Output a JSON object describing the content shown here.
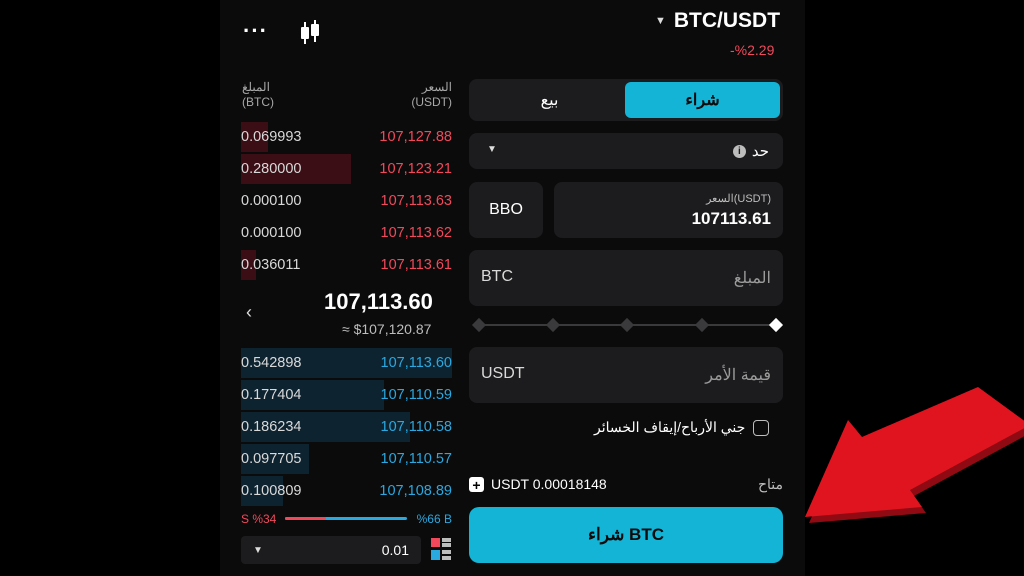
{
  "header": {
    "pair": "BTC/USDT",
    "change": "-%2.29",
    "more_icon": "more-horizontal-icon",
    "chart_icon": "candlestick-icon"
  },
  "orderbook": {
    "amount_label": "المبلغ",
    "amount_unit": "(BTC)",
    "price_label": "السعر",
    "price_unit": "(USDT)",
    "asks": [
      {
        "amount": "0.069993",
        "price": "107,127.88",
        "depth": 0.13
      },
      {
        "amount": "0.280000",
        "price": "107,123.21",
        "depth": 0.52
      },
      {
        "amount": "0.000100",
        "price": "107,113.63",
        "depth": 0.0
      },
      {
        "amount": "0.000100",
        "price": "107,113.62",
        "depth": 0.0
      },
      {
        "amount": "0.036011",
        "price": "107,113.61",
        "depth": 0.07
      }
    ],
    "mid_price": "107,113.60",
    "mid_fiat": "≈ $107,120.87",
    "bids": [
      {
        "amount": "0.542898",
        "price": "107,113.60",
        "depth": 1.0
      },
      {
        "amount": "0.177404",
        "price": "107,110.59",
        "depth": 0.68
      },
      {
        "amount": "0.186234",
        "price": "107,110.58",
        "depth": 0.8
      },
      {
        "amount": "0.097705",
        "price": "107,110.57",
        "depth": 0.32
      },
      {
        "amount": "0.100809",
        "price": "107,108.89",
        "depth": 0.2
      }
    ],
    "sell_ratio": "S %34",
    "buy_ratio": "%66 B",
    "sell_fraction": 0.34,
    "precision": "0.01"
  },
  "trade": {
    "buy_tab": "شراء",
    "sell_tab": "بيع",
    "order_type": "حد",
    "bbo": "BBO",
    "price_label": "السعر(USDT)",
    "price_value": "107113.61",
    "amount_placeholder": "المبلغ",
    "amount_unit": "BTC",
    "value_placeholder": "قيمة الأمر",
    "value_unit": "USDT",
    "tpsl_label": "جني الأرباح/إيقاف الخسائر",
    "available_label": "متاح",
    "available_value": "USDT 0.00018148",
    "buy_button": "شراء BTC"
  },
  "colors": {
    "accent": "#14b4d6",
    "ask": "#f1495b",
    "bid": "#2aa8e0",
    "annotation_arrow": "#e0141e"
  }
}
